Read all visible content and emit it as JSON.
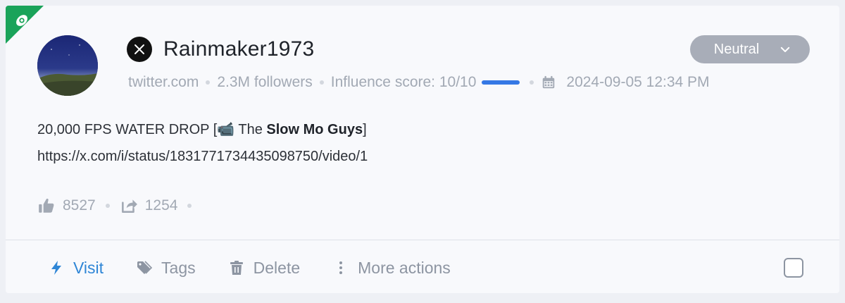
{
  "post": {
    "author": {
      "username": "Rainmaker1973",
      "platform_icon": "x-logo-icon",
      "avatar_icon": "night-sky-avatar"
    },
    "meta": {
      "source": "twitter.com",
      "followers": "2.3M followers",
      "influence_label": "Influence score: 10/10",
      "influence_fraction": 1.0,
      "date": "2024-09-05 12:34 PM"
    },
    "sentiment": {
      "value": "Neutral"
    },
    "content": {
      "text_before": "20,000 FPS WATER DROP [",
      "emoji": "📹",
      "text_middle": " The ",
      "bold": "Slow Mo Guys",
      "text_after": "]",
      "link": "https://x.com/i/status/1831771734435098750/video/1"
    },
    "stats": {
      "likes": "8527",
      "shares": "1254"
    },
    "actions": {
      "visit": "Visit",
      "tags": "Tags",
      "delete": "Delete",
      "more": "More actions"
    },
    "colors": {
      "accent": "#2f86d6",
      "badge": "#1aa35a",
      "score_bar": "#3578e5",
      "sentiment_bg": "#a8adb8"
    }
  }
}
